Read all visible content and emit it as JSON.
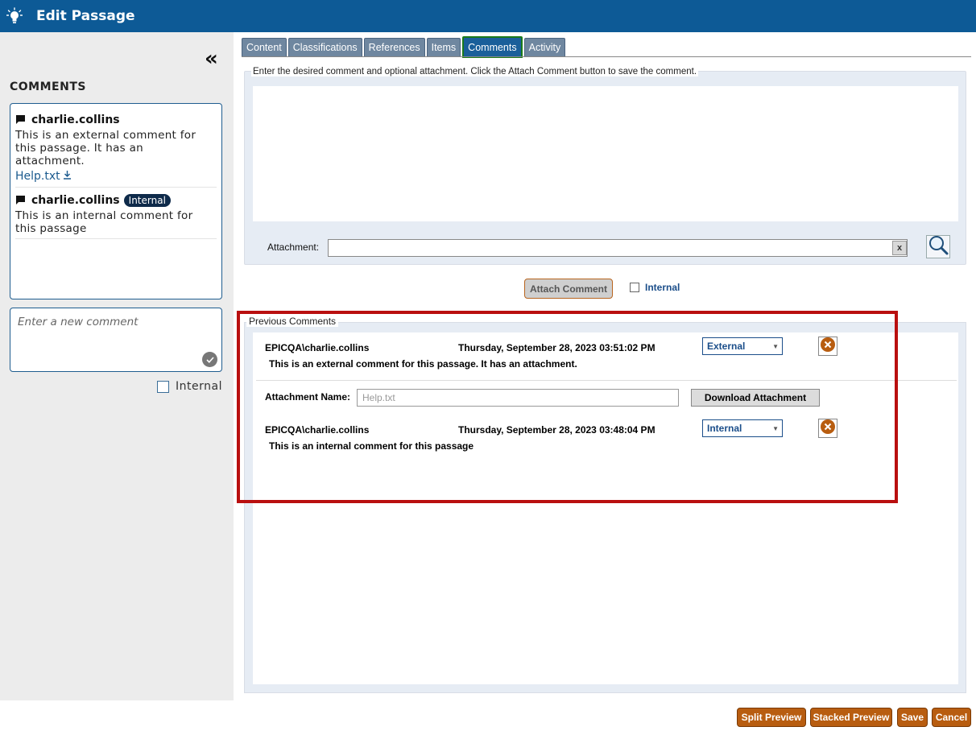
{
  "header": {
    "title": "Edit Passage",
    "icon": "lightbulb-icon"
  },
  "left_panel": {
    "collapse_glyph": "«",
    "heading": "COMMENTS",
    "comments": [
      {
        "author": "charlie.collins",
        "badge": "",
        "text": "This is an external comment for this passage. It has an attachment.",
        "attachment": "Help.txt"
      },
      {
        "author": "charlie.collins",
        "badge": "Internal",
        "text": "This is an internal comment for this passage",
        "attachment": ""
      }
    ],
    "new_comment_placeholder": "Enter a new comment",
    "internal_label": "Internal"
  },
  "tabs": [
    {
      "label": "Content",
      "active": false
    },
    {
      "label": "Classifications",
      "active": false
    },
    {
      "label": "References",
      "active": false
    },
    {
      "label": "Items",
      "active": false
    },
    {
      "label": "Comments",
      "active": true
    },
    {
      "label": "Activity",
      "active": false
    }
  ],
  "new_comment": {
    "instructions": "Enter the desired comment and optional attachment. Click the Attach Comment button to save the comment.",
    "attachment_label": "Attachment:",
    "attachment_value": "",
    "clear_glyph": "x",
    "attach_button": "Attach Comment",
    "internal_label": "Internal"
  },
  "previous": {
    "legend": "Previous Comments",
    "items": [
      {
        "user": "EPICQA\\charlie.collins",
        "date": "Thursday, September 28, 2023 03:51:02 PM",
        "visibility": "External",
        "text": "This is an external comment for this passage.  It has an attachment.",
        "attachment_label": "Attachment Name:",
        "attachment_name": "Help.txt",
        "download_button": "Download Attachment"
      },
      {
        "user": "EPICQA\\charlie.collins",
        "date": "Thursday, September 28, 2023 03:48:04 PM",
        "visibility": "Internal",
        "text": "This is an internal comment for this passage"
      }
    ]
  },
  "footer": {
    "split_preview": "Split Preview",
    "stacked_preview": "Stacked Preview",
    "save": "Save",
    "cancel": "Cancel"
  },
  "colors": {
    "header": "#0d5a96",
    "tab": "#6f87a0",
    "tab_active_border": "#1a7a1a",
    "action_button": "#b85d10",
    "highlight_box": "#b90f0f"
  }
}
